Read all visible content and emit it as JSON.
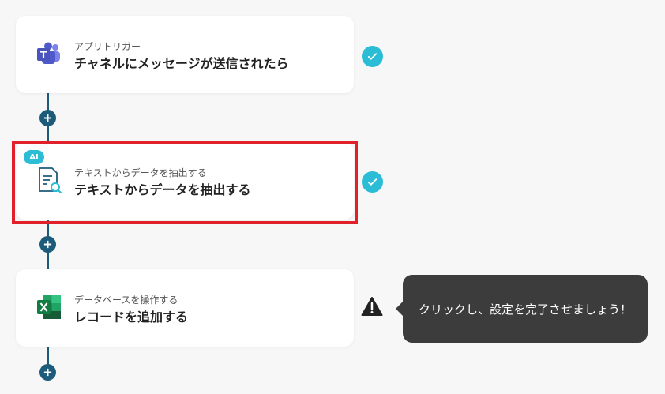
{
  "steps": [
    {
      "subtitle": "アプリトリガー",
      "title": "チャネルにメッセージが送信されたら",
      "icon": "teams-icon",
      "status": "complete"
    },
    {
      "badge": "AI",
      "subtitle": "テキストからデータを抽出する",
      "title": "テキストからデータを抽出する",
      "icon": "document-search-icon",
      "status": "complete",
      "highlighted": true
    },
    {
      "subtitle": "データベースを操作する",
      "title": "レコードを追加する",
      "icon": "excel-icon",
      "status": "warning"
    }
  ],
  "tooltip": {
    "text": "クリックし、設定を完了させましょう！"
  },
  "colors": {
    "connector": "#1c5b7a",
    "check": "#2bbcd6",
    "highlight": "#e0202a",
    "tooltip_bg": "#3c3c3c"
  }
}
